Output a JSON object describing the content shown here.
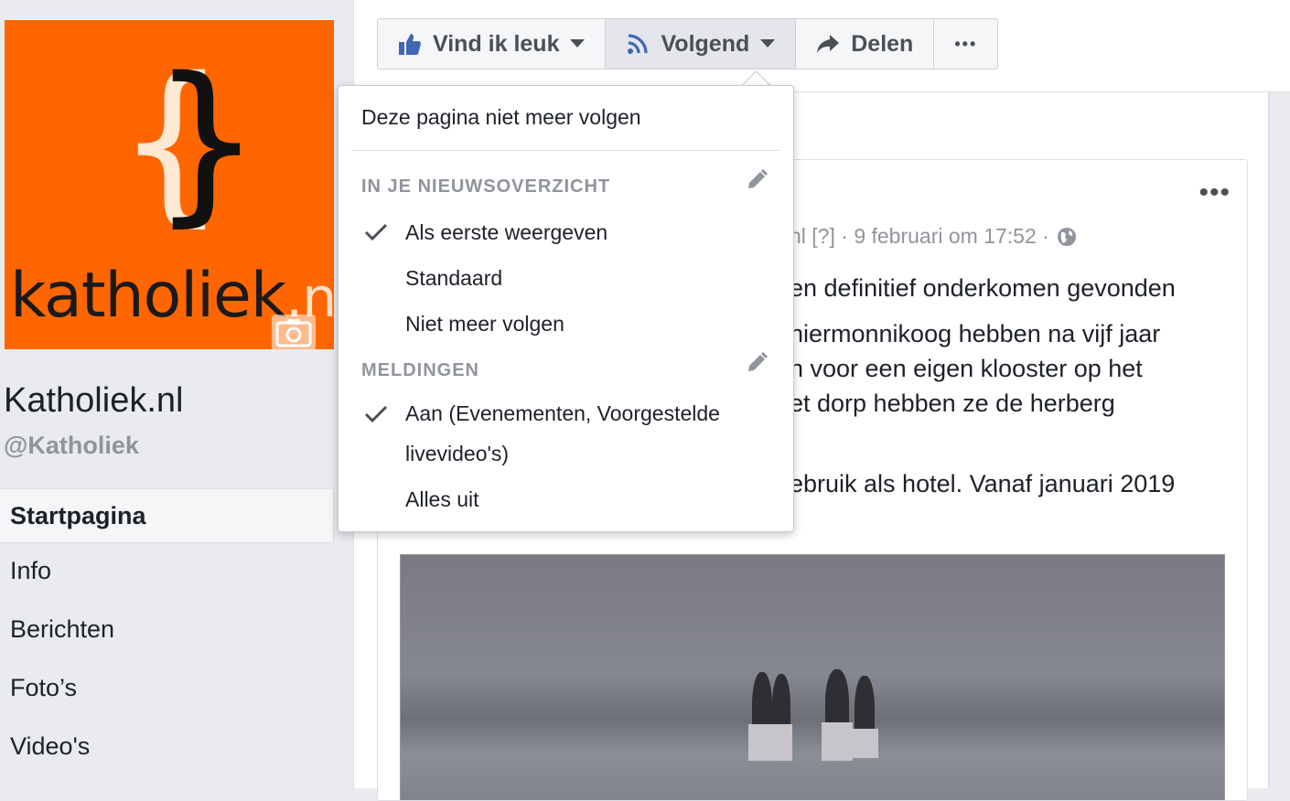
{
  "page": {
    "logo_text": "katholiek",
    "logo_suffix": ".nl",
    "name": "Katholiek.nl",
    "handle": "@Katholiek"
  },
  "nav": {
    "items": [
      "Startpagina",
      "Info",
      "Berichten",
      "Foto’s",
      "Video's"
    ],
    "active": "Startpagina"
  },
  "actions": {
    "like": "Vind ik leuk",
    "follow": "Volgend",
    "share": "Delen",
    "more": "•••"
  },
  "dropdown": {
    "unfollow_page": "Deze pagina niet meer volgen",
    "newsfeed_header": "IN JE NIEUWSOVERZICHT",
    "newsfeed_options": [
      "Als eerste weergeven",
      "Standaard",
      "Niet meer volgen"
    ],
    "newsfeed_selected": "Als eerste weergeven",
    "notifications_header": "MELDINGEN",
    "notifications_on_line1": "Aan (Evenementen, Voorgestelde",
    "notifications_on_line2": "livevideo's)",
    "notifications_off": "Alles uit",
    "notifications_selected": "Aan"
  },
  "post": {
    "meta_prefix": "nl",
    "meta_flag": "[?]",
    "meta_date": "· 9 februari om 17:52 ·",
    "lines": [
      "en definitief onderkomen gevonden",
      "hiermonnikoog hebben na vijf jaar",
      "n voor een eigen klooster op het",
      "et dorp hebben ze de herberg",
      "ebruik als hotel. Vanaf januari 2019"
    ],
    "more_label": "•••"
  },
  "colors": {
    "logo_bg": "#ff6600",
    "fb_blue": "#4267b2",
    "muted": "#90949c"
  }
}
